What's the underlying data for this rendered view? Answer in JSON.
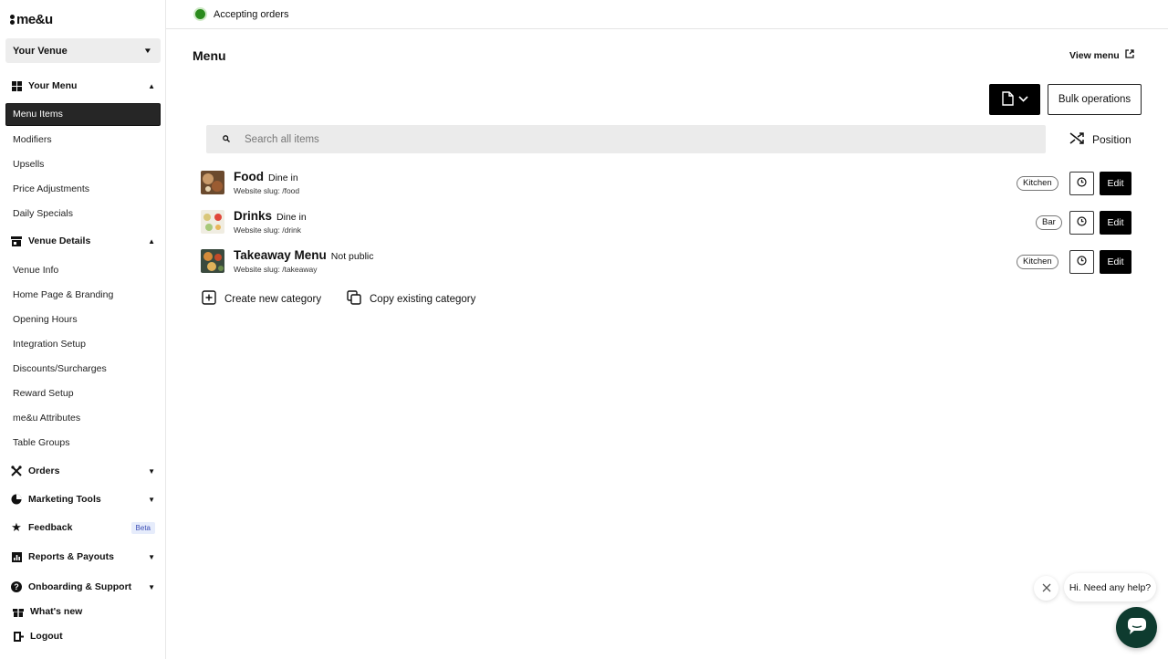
{
  "app": {
    "logo_text": "me&u"
  },
  "sidebar": {
    "venue": "Your Venue",
    "your_menu": {
      "label": "Your Menu",
      "items": [
        "Menu Items",
        "Modifiers",
        "Upsells",
        "Price Adjustments",
        "Daily Specials"
      ]
    },
    "venue_details": {
      "label": "Venue Details",
      "items": [
        "Venue Info",
        "Home Page & Branding",
        "Opening Hours",
        "Integration Setup",
        "Discounts/Surcharges",
        "Reward Setup",
        "me&u Attributes",
        "Table Groups"
      ]
    },
    "orders": "Orders",
    "marketing": "Marketing Tools",
    "feedback": {
      "label": "Feedback",
      "badge": "Beta"
    },
    "reports": "Reports & Payouts",
    "onboarding": "Onboarding & Support",
    "whats_new": "What's new",
    "logout": "Logout"
  },
  "topbar": {
    "status": "Accepting orders",
    "status_color": "#2a8a1c"
  },
  "main": {
    "title": "Menu",
    "view_menu": "View menu",
    "bulk_operations": "Bulk operations",
    "search_placeholder": "Search all items",
    "position": "Position",
    "categories": [
      {
        "name": "Food",
        "tag": "Dine in",
        "slug": "Website slug: /food",
        "station": "Kitchen",
        "edit": "Edit"
      },
      {
        "name": "Drinks",
        "tag": "Dine in",
        "slug": "Website slug: /drink",
        "station": "Bar",
        "edit": "Edit"
      },
      {
        "name": "Takeaway Menu",
        "tag": "Not public",
        "slug": "Website slug: /takeaway",
        "station": "Kitchen",
        "edit": "Edit"
      }
    ],
    "create_category": "Create new category",
    "copy_category": "Copy existing category"
  },
  "help": {
    "message": "Hi. Need any help?"
  }
}
